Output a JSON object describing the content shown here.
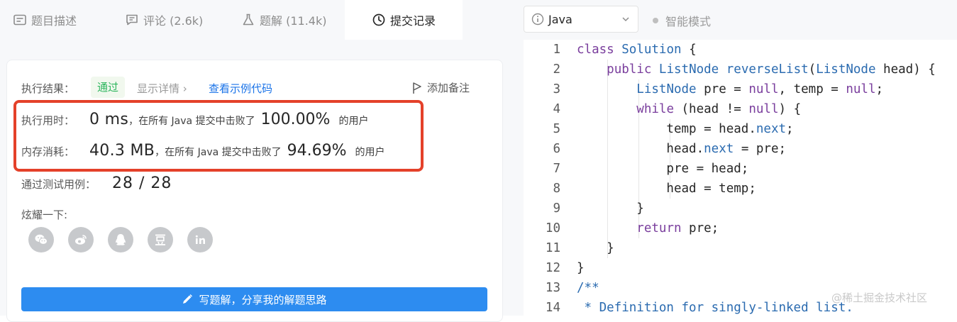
{
  "tabs": [
    {
      "label": "题目描述",
      "icon": "description-icon"
    },
    {
      "label": "评论 (2.6k)",
      "icon": "comment-icon"
    },
    {
      "label": "题解 (11.4k)",
      "icon": "flask-icon"
    },
    {
      "label": "提交记录",
      "icon": "clock-icon"
    }
  ],
  "result": {
    "label": "执行结果：",
    "status": "通过",
    "details_link": "显示详情 ›",
    "sample_link": "查看示例代码",
    "note_button": "添加备注"
  },
  "stats": {
    "runtime": {
      "label": "执行用时：",
      "value": "0 ms",
      "text": "，在所有 Java 提交中击败了",
      "percent": "100.00%",
      "suffix": "的用户"
    },
    "memory": {
      "label": "内存消耗：",
      "value": "40.3 MB",
      "text": "，在所有 Java 提交中击败了",
      "percent": "94.69%",
      "suffix": "的用户"
    }
  },
  "cases": {
    "label": "通过测试用例：",
    "value": "28 / 28"
  },
  "share": {
    "label": "炫耀一下:",
    "icons": [
      "wechat-icon",
      "weibo-icon",
      "qq-icon",
      "douban-icon",
      "linkedin-icon"
    ]
  },
  "write_button": "写题解，分享我的解题思路",
  "editor": {
    "language": "Java",
    "smart_mode": "智能模式",
    "lines": [
      {
        "n": "1",
        "html": "<span class=\"kw\">class</span> <span class=\"ty\">Solution</span> {"
      },
      {
        "n": "2",
        "html": "    <span class=\"kw\">public</span> <span class=\"ty\">ListNode</span> <span class=\"fn\">reverseList</span>(<span class=\"ty\">ListNode</span> head) {"
      },
      {
        "n": "3",
        "html": "        <span class=\"ty\">ListNode</span> pre = <span class=\"kw\">null</span>, temp = <span class=\"kw\">null</span>;"
      },
      {
        "n": "4",
        "html": "        <span class=\"kw\">while</span> (head != <span class=\"kw\">null</span>) {"
      },
      {
        "n": "5",
        "html": "            temp = head.<span class=\"fn\">next</span>;"
      },
      {
        "n": "6",
        "html": "            head.<span class=\"fn\">next</span> = pre;"
      },
      {
        "n": "7",
        "html": "            pre = head;"
      },
      {
        "n": "8",
        "html": "            head = temp;"
      },
      {
        "n": "9",
        "html": "        }"
      },
      {
        "n": "10",
        "html": "        <span class=\"kw\">return</span> pre;"
      },
      {
        "n": "11",
        "html": "    }"
      },
      {
        "n": "12",
        "html": "}"
      },
      {
        "n": "13",
        "html": "<span class=\"cm\">/**</span>"
      },
      {
        "n": "14",
        "html": "<span class=\"cm\"> * Definition for singly-linked list.</span>"
      }
    ]
  },
  "watermark": "@稀土掘金技术社区",
  "colors": {
    "accent": "#2d8cf0",
    "success": "#2db55d",
    "highlight": "#e4412a"
  }
}
